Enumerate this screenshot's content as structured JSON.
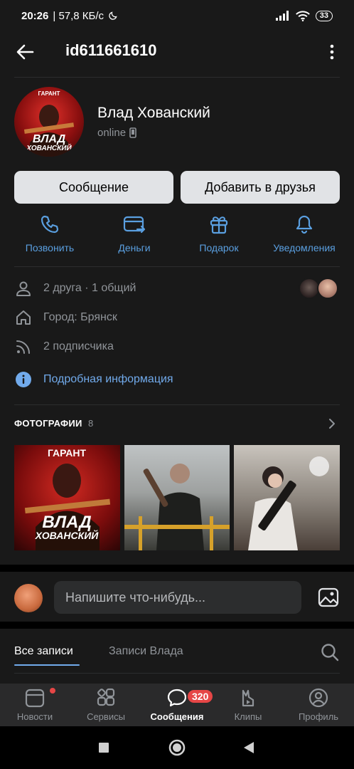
{
  "status_bar": {
    "time": "20:26",
    "network_speed": "| 57,8 КБ/с",
    "battery": "33"
  },
  "header": {
    "title": "id611661610"
  },
  "profile": {
    "name": "Влад Хованский",
    "status": "online",
    "avatar_lines": [
      "ГАРАНТ",
      "ВЛАД",
      "ХОВАНСКИЙ"
    ]
  },
  "buttons": {
    "message": "Сообщение",
    "add_friend": "Добавить в друзья"
  },
  "actions": [
    {
      "label": "Позвонить",
      "icon": "phone-icon"
    },
    {
      "label": "Деньги",
      "icon": "money-icon"
    },
    {
      "label": "Подарок",
      "icon": "gift-icon"
    },
    {
      "label": "Уведомления",
      "icon": "bell-icon"
    }
  ],
  "info": {
    "friends": "2 друга · 1 общий",
    "city": "Город: Брянск",
    "followers": "2 подписчика",
    "details": "Подробная информация"
  },
  "photos": {
    "title": "ФОТОГРАФИИ",
    "count": "8",
    "p1_lines": [
      "ГАРАНТ",
      "ВЛАД",
      "ХОВАНСКИЙ"
    ]
  },
  "composer": {
    "placeholder": "Напишите что-нибудь..."
  },
  "tabs": {
    "all": "Все записи",
    "vlad": "Записи Влада"
  },
  "bottom_nav": [
    {
      "label": "Новости",
      "icon": "news-icon"
    },
    {
      "label": "Сервисы",
      "icon": "services-icon"
    },
    {
      "label": "Сообщения",
      "icon": "messages-icon",
      "badge": "320"
    },
    {
      "label": "Клипы",
      "icon": "clips-icon"
    },
    {
      "label": "Профиль",
      "icon": "profile-icon"
    }
  ],
  "colors": {
    "accent": "#71aaeb",
    "action": "#5a9fe0",
    "badge": "#e64646",
    "background": "#191919"
  }
}
